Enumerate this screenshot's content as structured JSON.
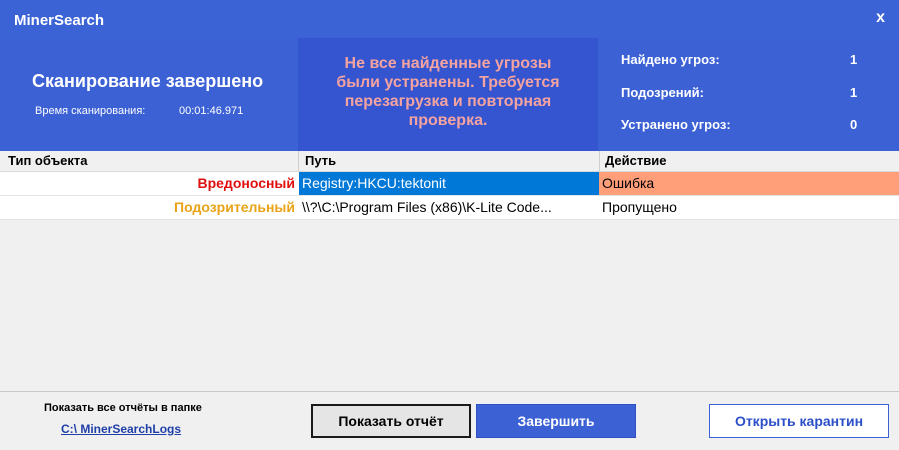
{
  "window": {
    "title": "MinerSearch",
    "close_label": "x"
  },
  "header": {
    "status": "Сканирование завершено",
    "time_label": "Время сканирования:",
    "time_value": "00:01:46.971",
    "warning_lines": [
      "Не все найденные угрозы",
      "были устранены. Требуется",
      "перезагрузка и повторная",
      "проверка."
    ],
    "warning_color": "#f4a3a0",
    "stats": [
      {
        "label": "Найдено угроз:",
        "value": "1"
      },
      {
        "label": "Подозрений:",
        "value": "1"
      },
      {
        "label": "Устранено угроз:",
        "value": "0"
      }
    ]
  },
  "table": {
    "columns": [
      "Тип объекта",
      "Путь",
      "Действие"
    ],
    "rows": [
      {
        "type": "Вредоносный",
        "path": "Registry:HKCU:tektonit",
        "action": "Ошибка",
        "type_color": "#e01010",
        "path_bg": "#0078d7",
        "action_bg": "#ff9f7a"
      },
      {
        "type": "Подозрительный",
        "path": "\\\\?\\C:\\Program Files (x86)\\K-Lite Code...",
        "action": "Пропущено",
        "type_color": "#e8a317",
        "path_bg": "#ffffff",
        "action_bg": "#ffffff"
      }
    ]
  },
  "footer": {
    "logs_label": "Показать все отчёты в папке",
    "logs_link": "C:\\ MinerSearchLogs",
    "buttons": {
      "report": "Показать отчёт",
      "finish": "Завершить",
      "quarantine": "Открыть карантин"
    }
  }
}
